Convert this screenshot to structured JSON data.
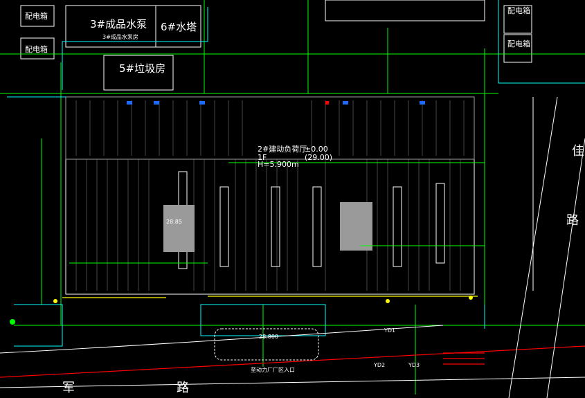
{
  "labels": {
    "pump_house": "3#成品水泵",
    "pump_house_sub": "3#成品水泵房",
    "water_tower": "6#水塔",
    "garbage_room": "5#垃圾房",
    "power_room_1": "配电箱",
    "power_room_2": "配电箱",
    "power_room_3": "配电箱",
    "power_room_4": "配电箱",
    "workshop": "2#建动负荷厅",
    "floor": "1F",
    "height": "H=5.900m",
    "elev_zero": "±0.00",
    "elev_value": "(29.00)",
    "center_value": "28.85",
    "entrance": "至动力厂厂区入口",
    "road_1": "军",
    "road_2": "路",
    "road_3": "路",
    "road_4": "佳",
    "pond": "28.800",
    "yd1": "YD1",
    "yd2": "YD2",
    "yd3": "YD3"
  },
  "colors": {
    "background": "#000000",
    "line_white": "#ffffff",
    "line_green": "#00ff00",
    "line_cyan": "#00ffff",
    "line_yellow": "#ffff00",
    "line_red": "#ff0000",
    "line_grey": "#a0a0a0",
    "fill_grey": "#9a9a9a"
  }
}
